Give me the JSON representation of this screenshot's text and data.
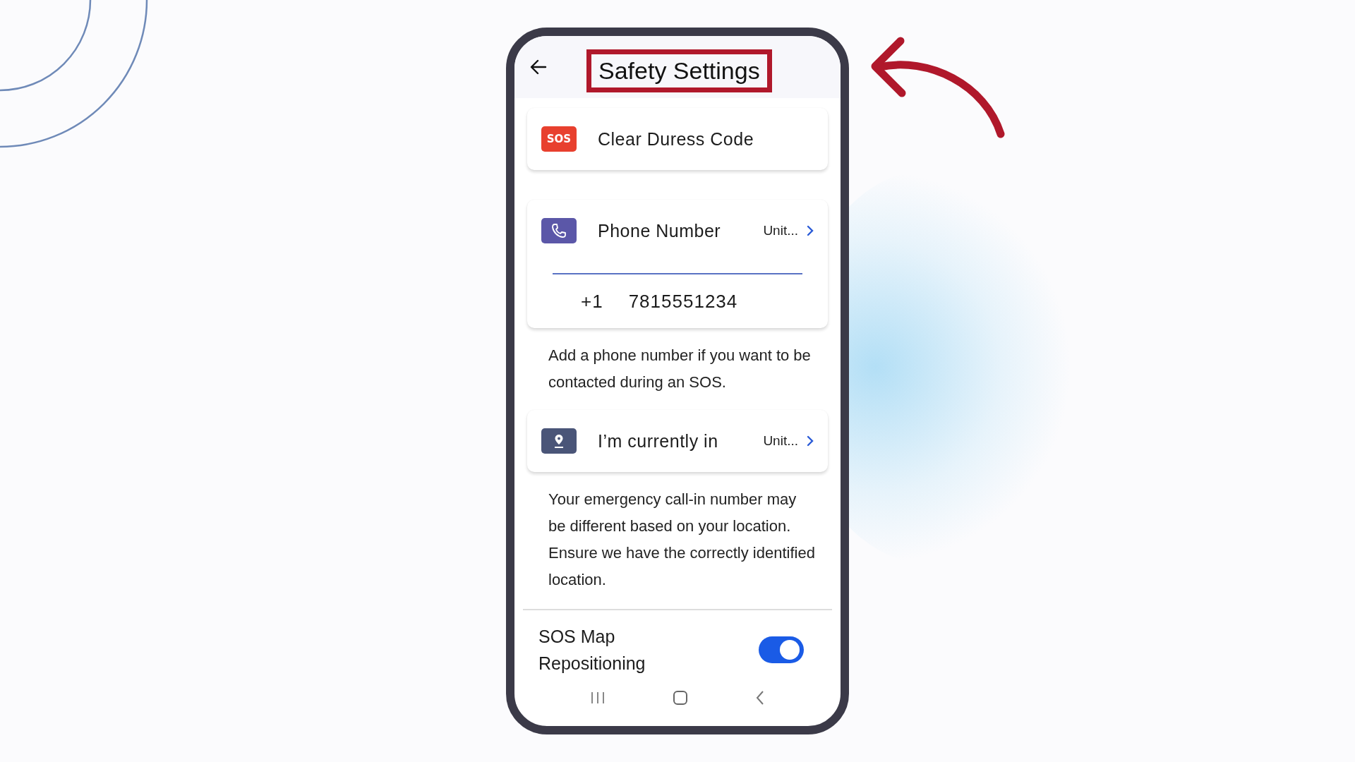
{
  "header": {
    "title": "Safety Settings"
  },
  "duress": {
    "icon_text": "SOS",
    "label": "Clear Duress Code"
  },
  "phone": {
    "label": "Phone Number",
    "region": "Unit...",
    "country_code": "+1",
    "number": "7815551234"
  },
  "phone_help": "Add a phone number if you want to be contacted during an SOS.",
  "location": {
    "label": "I’m currently in",
    "region": "Unit..."
  },
  "location_help": "Your emergency call-in number may be different based on your location. Ensure we have the correctly identified location.",
  "map_toggle": {
    "label": "SOS Map Repositioning",
    "on": true
  }
}
